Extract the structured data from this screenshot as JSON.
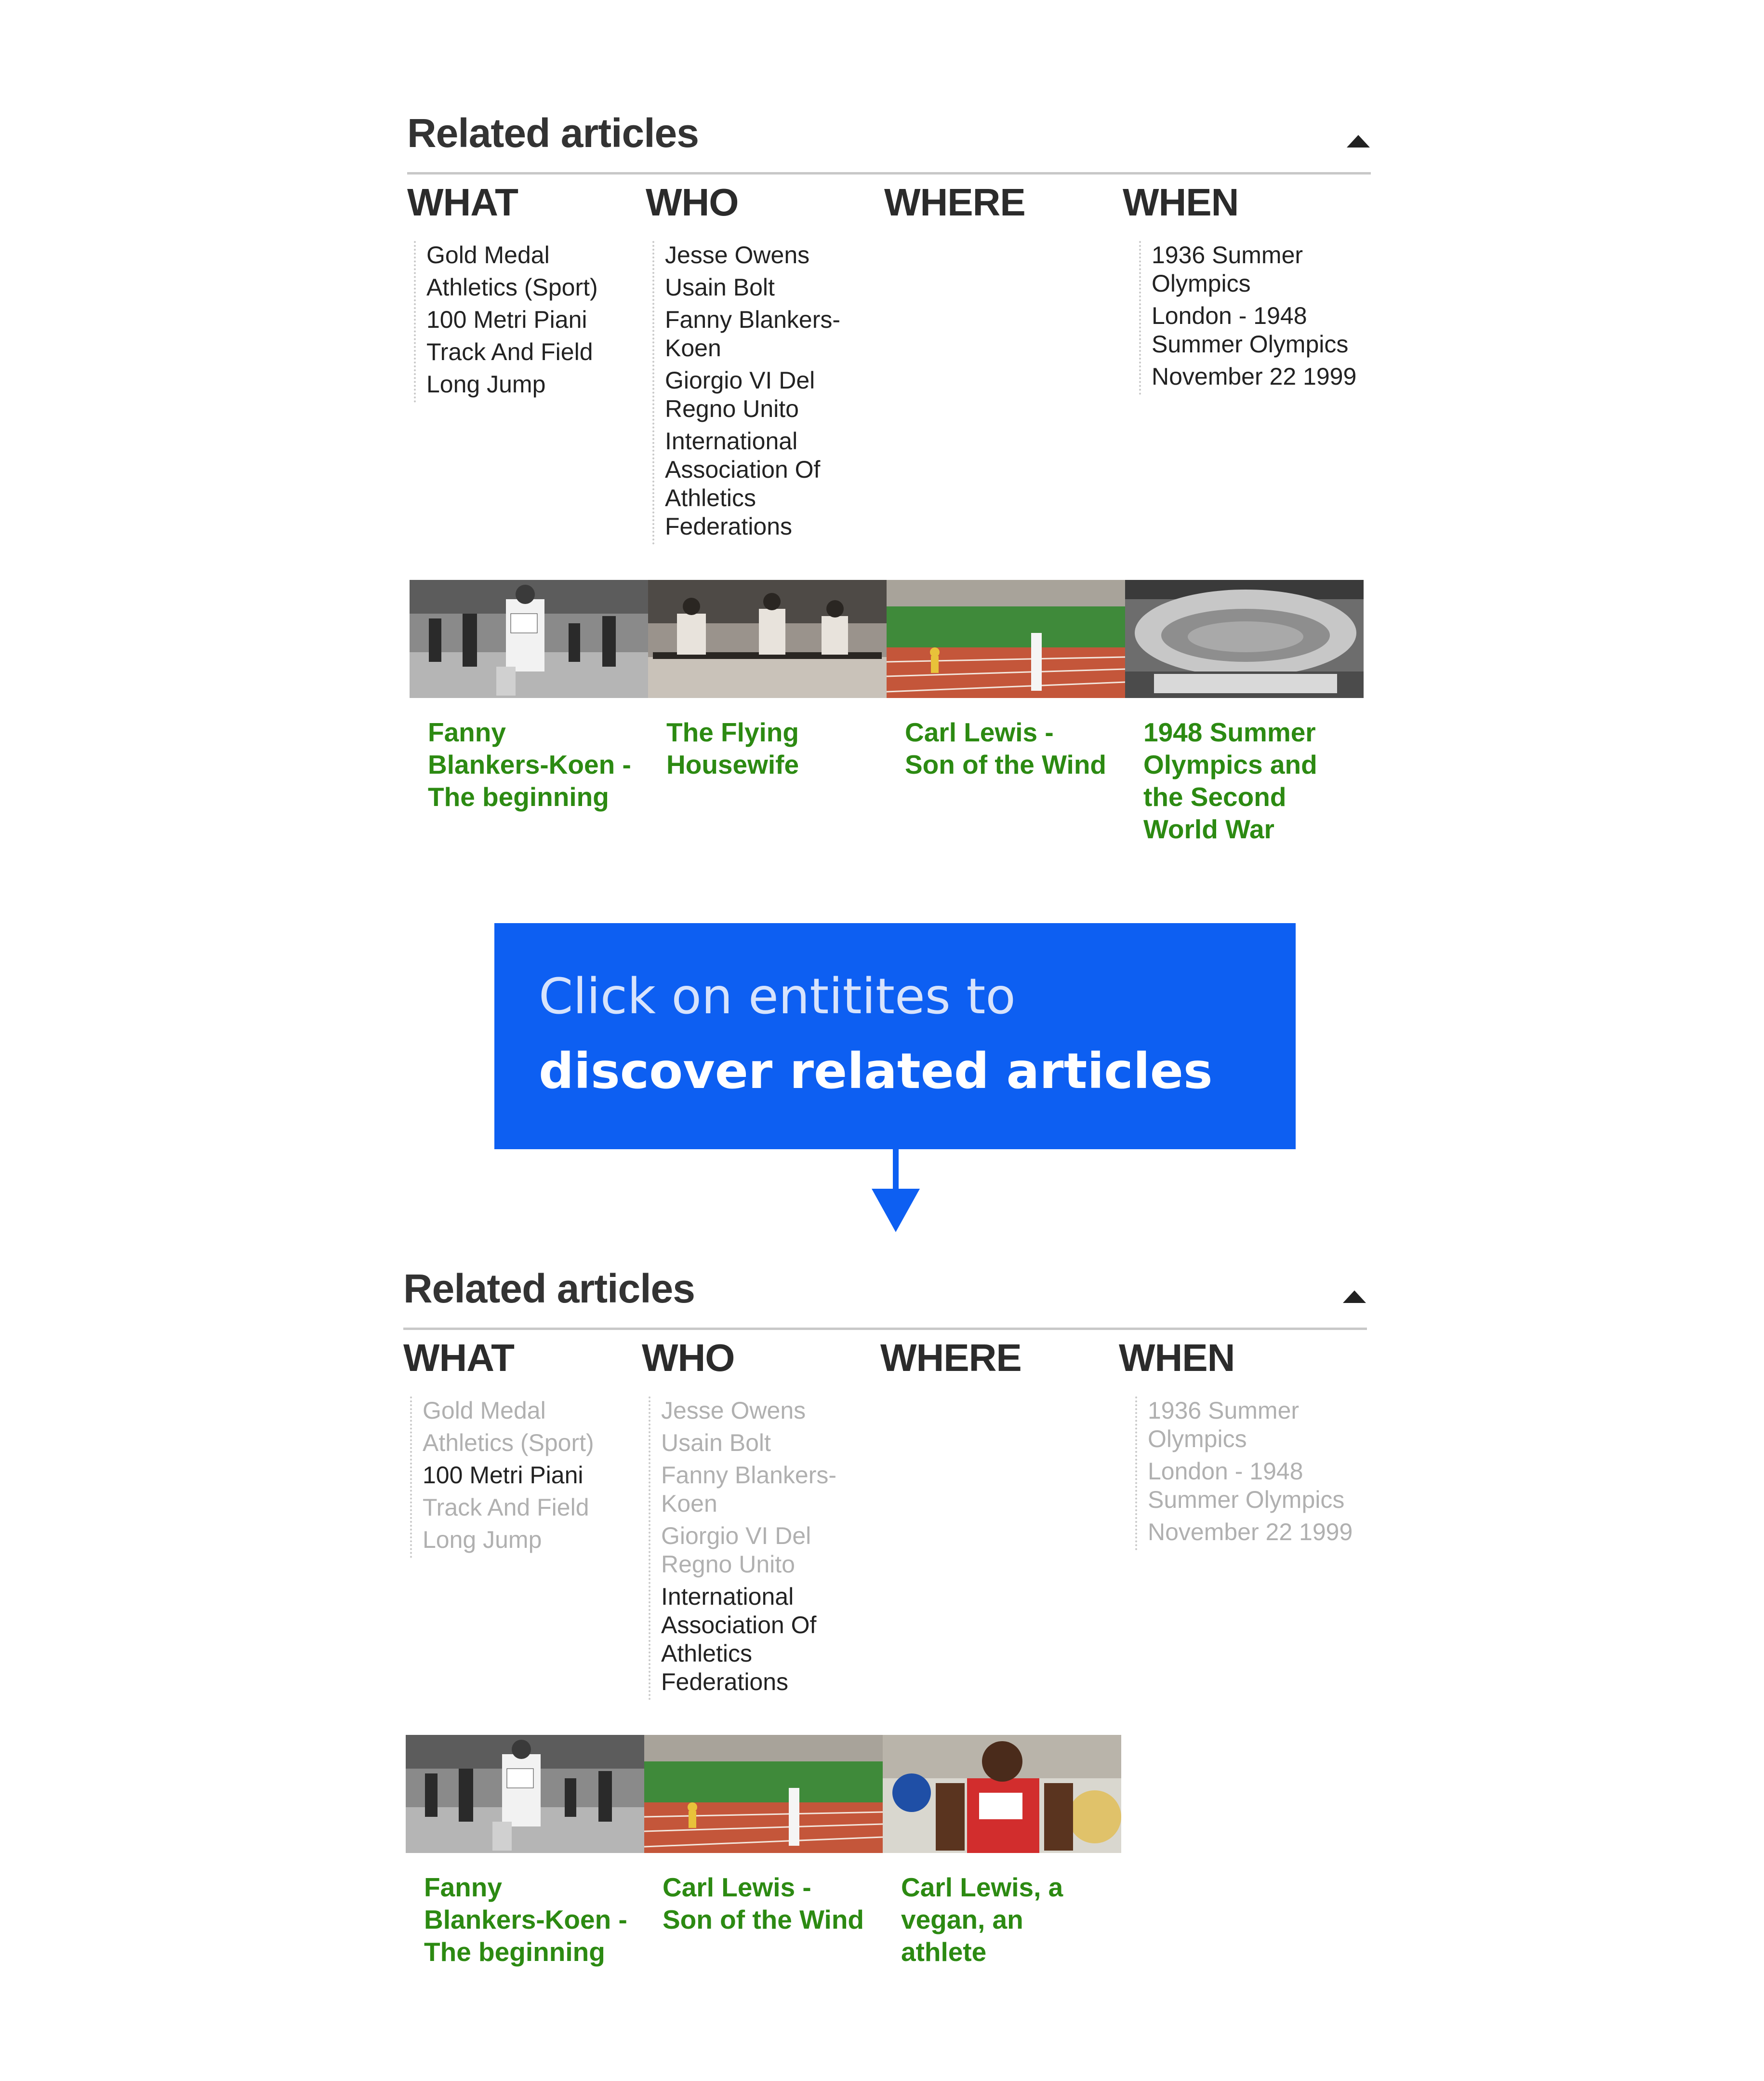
{
  "widget1": {
    "title": "Related articles",
    "columns": [
      {
        "heading": "WHAT",
        "items": [
          {
            "label": "Gold Medal",
            "dim": false
          },
          {
            "label": "Athletics (Sport)",
            "dim": false
          },
          {
            "label": "100 Metri Piani",
            "dim": false
          },
          {
            "label": "Track And Field",
            "dim": false
          },
          {
            "label": "Long Jump",
            "dim": false
          }
        ]
      },
      {
        "heading": "WHO",
        "items": [
          {
            "label": "Jesse Owens",
            "dim": false
          },
          {
            "label": "Usain Bolt",
            "dim": false
          },
          {
            "label": "Fanny Blankers-Koen",
            "dim": false
          },
          {
            "label": "Giorgio VI Del Regno Unito",
            "dim": false
          },
          {
            "label": "International Association Of Athletics Federations",
            "dim": false
          }
        ]
      },
      {
        "heading": "WHERE",
        "items": []
      },
      {
        "heading": "WHEN",
        "items": [
          {
            "label": "1936 Summer Olympics",
            "dim": false
          },
          {
            "label": "London - 1948 Summer Olympics",
            "dim": false
          },
          {
            "label": "November 22 1999",
            "dim": false
          }
        ]
      }
    ],
    "articles": [
      {
        "title": "Fanny Blankers-Koen - The beginning",
        "image": "vintage-sprint-photo"
      },
      {
        "title": "The Flying Housewife",
        "image": "vintage-hurdles-photo"
      },
      {
        "title": "Carl Lewis - Son of the Wind",
        "image": "stadium-track-photo"
      },
      {
        "title": "1948 Summer Olympics and the Second World War",
        "image": "stadium-aerial-photo"
      }
    ]
  },
  "callout": {
    "text_plain": "Click on entitites to ",
    "text_bold": "discover related articles"
  },
  "widget2": {
    "title": "Related articles",
    "columns": [
      {
        "heading": "WHAT",
        "items": [
          {
            "label": "Gold Medal",
            "dim": true
          },
          {
            "label": "Athletics (Sport)",
            "dim": true
          },
          {
            "label": "100 Metri Piani",
            "dim": false
          },
          {
            "label": "Track And Field",
            "dim": true
          },
          {
            "label": "Long Jump",
            "dim": true
          }
        ]
      },
      {
        "heading": "WHO",
        "items": [
          {
            "label": "Jesse Owens",
            "dim": true
          },
          {
            "label": "Usain Bolt",
            "dim": true
          },
          {
            "label": "Fanny Blankers-Koen",
            "dim": true
          },
          {
            "label": "Giorgio VI Del Regno Unito",
            "dim": true
          },
          {
            "label": "International Association Of Athletics Federations",
            "dim": false
          }
        ]
      },
      {
        "heading": "WHERE",
        "items": []
      },
      {
        "heading": "WHEN",
        "items": [
          {
            "label": "1936 Summer Olympics",
            "dim": true
          },
          {
            "label": "London - 1948 Summer Olympics",
            "dim": true
          },
          {
            "label": "November 22 1999",
            "dim": true
          }
        ]
      }
    ],
    "articles": [
      {
        "title": "Fanny Blankers-Koen - The beginning",
        "image": "vintage-sprint-photo"
      },
      {
        "title": "Carl Lewis - Son of the Wind",
        "image": "stadium-track-photo"
      },
      {
        "title": "Carl Lewis, a vegan, an athlete",
        "image": "sprinter-closeup-photo"
      }
    ]
  },
  "colors": {
    "accent_blue": "#0d5ff2",
    "link_green": "#2c8a12",
    "dim_text": "#b0b0b0"
  }
}
